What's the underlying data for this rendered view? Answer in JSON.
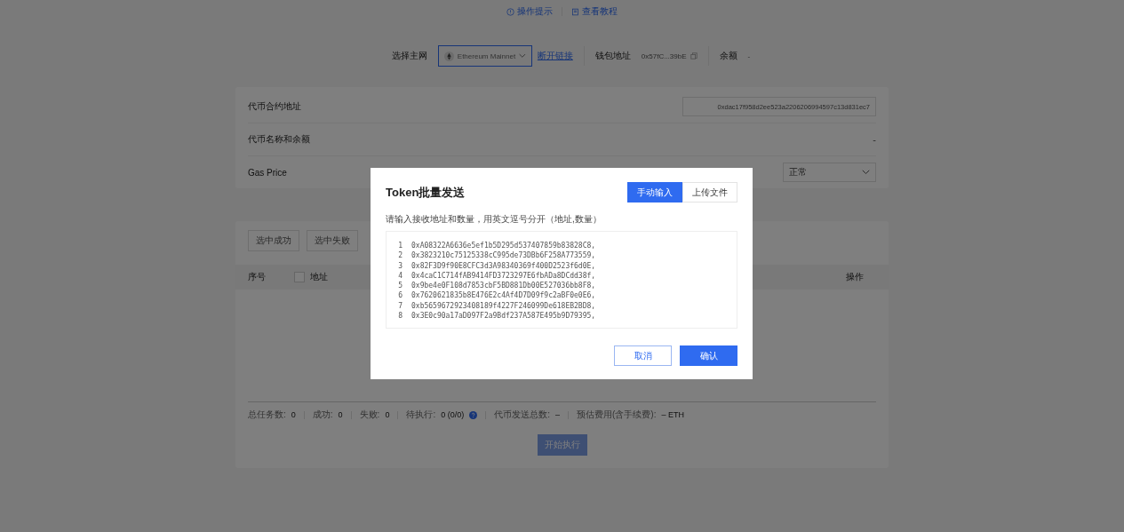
{
  "help_links": [
    {
      "kind": "info",
      "label": "操作提示"
    },
    {
      "kind": "doc",
      "label": "查看教程"
    }
  ],
  "network_bar": {
    "network_label": "选择主网",
    "network": "Ethereum Mainnet",
    "disconnect": "断开链接",
    "wallet_label": "钱包地址",
    "wallet": "0x57fC...39bE",
    "balance_label": "余额",
    "balance": "-"
  },
  "token_form": {
    "contract_label": "代币合约地址",
    "contract": "0xdac17f958d2ee523a2206206994597c13d831ec7",
    "name_label": "代币名称和余额",
    "name_value": "-",
    "gas_label": "Gas Price",
    "gas": "正常"
  },
  "task_panel": {
    "filters": [
      "选中成功",
      "选中失败"
    ],
    "columns": [
      "序号",
      "地址",
      "操作"
    ],
    "select_all": {
      "checked": false
    },
    "stats": [
      {
        "label": "总任务数:",
        "value": "0"
      },
      {
        "label": "成功:",
        "value": "0"
      },
      {
        "label": "失败:",
        "value": "0"
      },
      {
        "label": "待执行:",
        "value": "0 (0/0)",
        "help": true
      },
      {
        "label": "代币发送总数:",
        "value": "–"
      },
      {
        "label": "预估费用(含手续费):",
        "value": "– ETH"
      }
    ],
    "start_button": {
      "label": "开始执行",
      "disabled": true
    }
  },
  "dialog": {
    "title": "Token批量发送",
    "tabs": [
      {
        "label": "手动输入",
        "selected": true
      },
      {
        "label": "上传文件",
        "selected": false
      }
    ],
    "hint": "请输入接收地址和数量，用英文逗号分开（地址,数量）",
    "lines": [
      {
        "number": "1",
        "text": "0xA08322A6636e5ef1b5D295d537407859b83828C8,"
      },
      {
        "number": "2",
        "text": "0x3823210c75125338cC995de73DBb6F258A773559,"
      },
      {
        "number": "3",
        "text": "0x82F3D9f90E8CFC3d3A98340369f400D2523f6d0E,"
      },
      {
        "number": "4",
        "text": "0x4caC1C714fAB9414FD3723297E6fbADa8DCdd38f,"
      },
      {
        "number": "5",
        "text": "0x9be4e0F108d7853cbF5BD881Db00E527036bb8F8,"
      },
      {
        "number": "6",
        "text": "0x7620621835b8E476E2c4Af4D7D09f9c2aBF0e0E6,"
      },
      {
        "number": "7",
        "text": "0xb5659672923408189f4227F246099De618EB2BD8,"
      },
      {
        "number": "8",
        "text": "0x3E0c90a17aD097F2a9Bdf237A587E495b9D79395,"
      }
    ],
    "cancel": "取消",
    "confirm": "确认"
  }
}
